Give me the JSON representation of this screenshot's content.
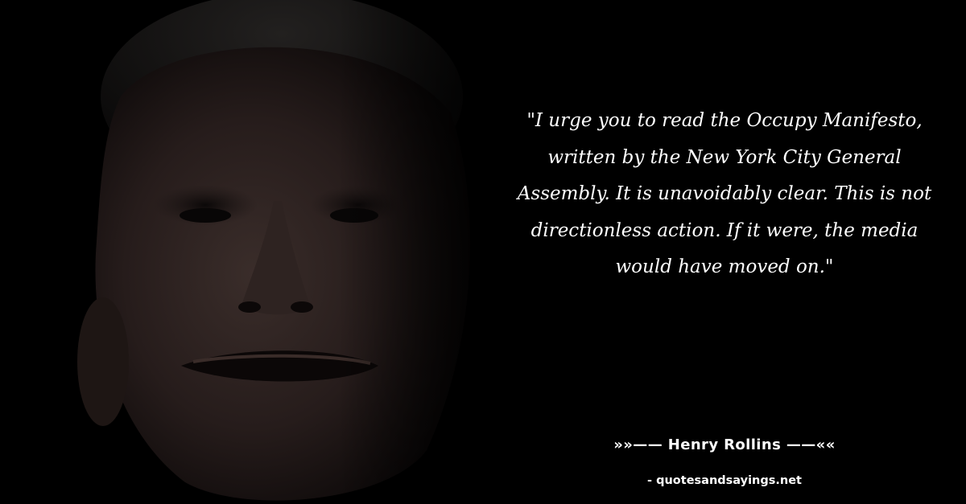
{
  "quote": {
    "text": "\"I urge you to read the Occupy Manifesto, written by the New York City General Assembly. It is unavoidably clear. This is not directionless action. If it were, the media would have moved on.\""
  },
  "attribution": {
    "author_line": "»»—— Henry Rollins ——««"
  },
  "footer": {
    "source": "- quotesandsayings.net"
  },
  "colors": {
    "background": "#000000",
    "text": "#ffffff"
  }
}
